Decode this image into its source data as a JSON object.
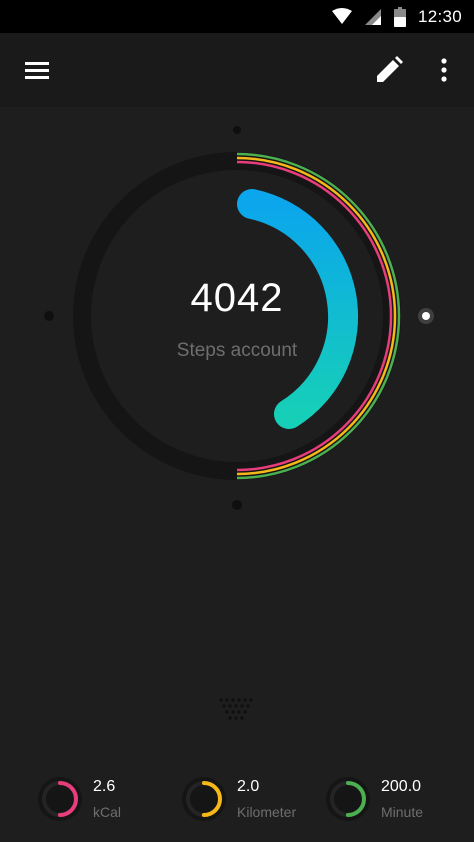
{
  "status_bar": {
    "time": "12:30",
    "icons": [
      "wifi-icon",
      "cellular-signal-icon",
      "battery-icon"
    ]
  },
  "toolbar": {
    "icons": [
      "hamburger-menu-icon",
      "pencil-edit-icon",
      "overflow-menu-icon"
    ]
  },
  "steps": {
    "value": "4042",
    "label": "Steps account"
  },
  "stats": [
    {
      "value": "2.6",
      "label": "kCal",
      "color": "#e83d7c",
      "progress": 0.5
    },
    {
      "value": "2.0",
      "label": "Kilometer",
      "color": "#f5b818",
      "progress": 0.5
    },
    {
      "value": "200.0",
      "label": "Minute",
      "color": "#4caf50",
      "progress": 0.5
    }
  ],
  "colors": {
    "background": "#1e1e1e",
    "toolbar": "#1a1a1a",
    "track": "#151515",
    "steps_gradient_start": "#0ba6ec",
    "steps_gradient_end": "#16cfb8",
    "pink": "#e83d7c",
    "yellow": "#f5b818",
    "green": "#4caf50"
  }
}
